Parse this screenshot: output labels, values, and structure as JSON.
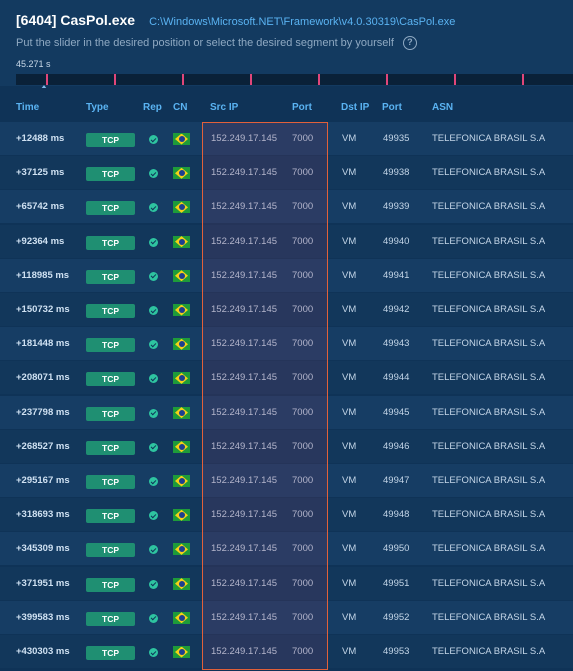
{
  "header": {
    "title": "[6404] CasPol.exe",
    "path": "C:\\Windows\\Microsoft.NET\\Framework\\v4.0.30319\\CasPol.exe",
    "hint": "Put the slider in the desired position or select the desired segment by yourself",
    "help_icon_glyph": "?",
    "duration": "45.271 s"
  },
  "timeline": {
    "slider_position": 0.055,
    "tick_icon": "connection-marker"
  },
  "columns": [
    "Time",
    "Type",
    "Rep",
    "CN",
    "Src IP",
    "Port",
    "Dst IP",
    "Port",
    "ASN"
  ],
  "rows": [
    {
      "time": "+12488 ms",
      "type": "TCP",
      "src_ip": "152.249.17.145",
      "src_port": "7000",
      "dst_ip": "VM",
      "dst_port": "49935",
      "asn": "TELEFONICA BRASIL S.A"
    },
    {
      "time": "+37125 ms",
      "type": "TCP",
      "src_ip": "152.249.17.145",
      "src_port": "7000",
      "dst_ip": "VM",
      "dst_port": "49938",
      "asn": "TELEFONICA BRASIL S.A"
    },
    {
      "time": "+65742 ms",
      "type": "TCP",
      "src_ip": "152.249.17.145",
      "src_port": "7000",
      "dst_ip": "VM",
      "dst_port": "49939",
      "asn": "TELEFONICA BRASIL S.A"
    },
    {
      "time": "+92364 ms",
      "type": "TCP",
      "src_ip": "152.249.17.145",
      "src_port": "7000",
      "dst_ip": "VM",
      "dst_port": "49940",
      "asn": "TELEFONICA BRASIL S.A"
    },
    {
      "time": "+118985 ms",
      "type": "TCP",
      "src_ip": "152.249.17.145",
      "src_port": "7000",
      "dst_ip": "VM",
      "dst_port": "49941",
      "asn": "TELEFONICA BRASIL S.A"
    },
    {
      "time": "+150732 ms",
      "type": "TCP",
      "src_ip": "152.249.17.145",
      "src_port": "7000",
      "dst_ip": "VM",
      "dst_port": "49942",
      "asn": "TELEFONICA BRASIL S.A"
    },
    {
      "time": "+181448 ms",
      "type": "TCP",
      "src_ip": "152.249.17.145",
      "src_port": "7000",
      "dst_ip": "VM",
      "dst_port": "49943",
      "asn": "TELEFONICA BRASIL S.A"
    },
    {
      "time": "+208071 ms",
      "type": "TCP",
      "src_ip": "152.249.17.145",
      "src_port": "7000",
      "dst_ip": "VM",
      "dst_port": "49944",
      "asn": "TELEFONICA BRASIL S.A"
    },
    {
      "time": "+237798 ms",
      "type": "TCP",
      "src_ip": "152.249.17.145",
      "src_port": "7000",
      "dst_ip": "VM",
      "dst_port": "49945",
      "asn": "TELEFONICA BRASIL S.A"
    },
    {
      "time": "+268527 ms",
      "type": "TCP",
      "src_ip": "152.249.17.145",
      "src_port": "7000",
      "dst_ip": "VM",
      "dst_port": "49946",
      "asn": "TELEFONICA BRASIL S.A"
    },
    {
      "time": "+295167 ms",
      "type": "TCP",
      "src_ip": "152.249.17.145",
      "src_port": "7000",
      "dst_ip": "VM",
      "dst_port": "49947",
      "asn": "TELEFONICA BRASIL S.A"
    },
    {
      "time": "+318693 ms",
      "type": "TCP",
      "src_ip": "152.249.17.145",
      "src_port": "7000",
      "dst_ip": "VM",
      "dst_port": "49948",
      "asn": "TELEFONICA BRASIL S.A"
    },
    {
      "time": "+345309 ms",
      "type": "TCP",
      "src_ip": "152.249.17.145",
      "src_port": "7000",
      "dst_ip": "VM",
      "dst_port": "49950",
      "asn": "TELEFONICA BRASIL S.A"
    },
    {
      "time": "+371951 ms",
      "type": "TCP",
      "src_ip": "152.249.17.145",
      "src_port": "7000",
      "dst_ip": "VM",
      "dst_port": "49951",
      "asn": "TELEFONICA BRASIL S.A"
    },
    {
      "time": "+399583 ms",
      "type": "TCP",
      "src_ip": "152.249.17.145",
      "src_port": "7000",
      "dst_ip": "VM",
      "dst_port": "49952",
      "asn": "TELEFONICA BRASIL S.A"
    },
    {
      "time": "+430303 ms",
      "type": "TCP",
      "src_ip": "152.249.17.145",
      "src_port": "7000",
      "dst_ip": "VM",
      "dst_port": "49953",
      "asn": "TELEFONICA BRASIL S.A"
    }
  ],
  "icons": {
    "rep": "check-circle-icon",
    "country": "brazil-flag-icon"
  },
  "colors": {
    "background": "#0f3357",
    "accent": "#5ab3f2",
    "protocol_badge": "#1f8f72",
    "timeline_tick": "#e0467a",
    "highlight": "#e2603a"
  }
}
